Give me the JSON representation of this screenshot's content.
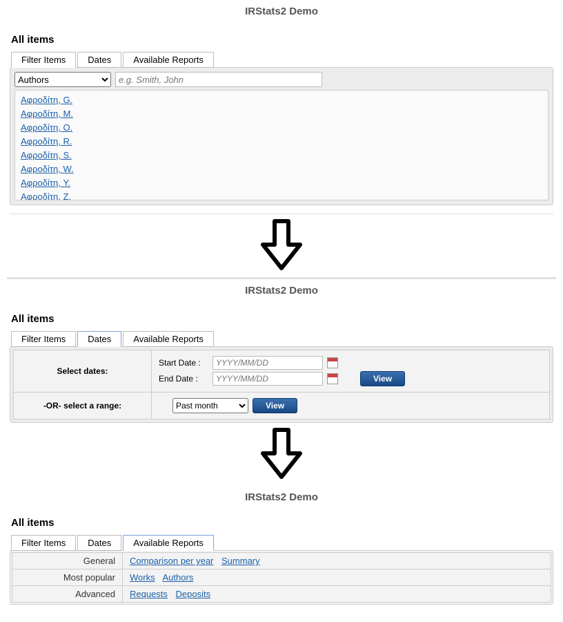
{
  "app_title": "IRStats2 Demo",
  "section_title": "All items",
  "tabs": {
    "filter": "Filter Items",
    "dates": "Dates",
    "reports": "Available Reports"
  },
  "panel1": {
    "select_label": "Authors",
    "search_placeholder": "e.g. Smith, John",
    "authors": [
      "Αφροδίτη, G.",
      "Αφροδίτη, M.",
      "Αφροδίτη, O.",
      "Αφροδίτη, R.",
      "Αφροδίτη, S.",
      "Αφροδίτη, W.",
      "Αφροδίτη, Y.",
      "Αφροδίτη, Z."
    ]
  },
  "panel2": {
    "select_dates_label": "Select dates:",
    "start_date_label": "Start Date :",
    "end_date_label": "End Date :",
    "date_placeholder": "YYYY/MM/DD",
    "view_label": "View",
    "or_range_label": "-OR- select a range:",
    "range_value": "Past month"
  },
  "panel3": {
    "categories": [
      {
        "name": "General",
        "links": [
          "Comparison per year",
          "Summary"
        ]
      },
      {
        "name": "Most popular",
        "links": [
          "Works",
          "Authors"
        ]
      },
      {
        "name": "Advanced",
        "links": [
          "Requests",
          "Deposits"
        ]
      }
    ]
  }
}
